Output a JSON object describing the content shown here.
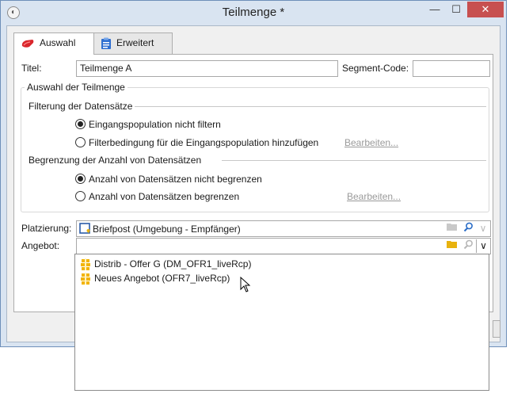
{
  "window": {
    "title": "Teilmenge *",
    "close_glyph": "✕",
    "min_glyph": "—",
    "max_glyph": "☐"
  },
  "tabs": [
    {
      "label": "Auswahl",
      "icon": "red-pill-icon",
      "active": true
    },
    {
      "label": "Erweitert",
      "icon": "clipboard-icon",
      "active": false
    }
  ],
  "form": {
    "title_label": "Titel:",
    "title_value": "Teilmenge A",
    "segment_label": "Segment-Code:",
    "segment_value": ""
  },
  "selection": {
    "group_title": "Auswahl der Teilmenge",
    "filter_section": "Filterung der Datensätze",
    "filter_options": [
      {
        "label": "Eingangspopulation nicht filtern",
        "selected": true
      },
      {
        "label": "Filterbedingung für die Eingangspopulation hinzufügen",
        "selected": false
      }
    ],
    "filter_edit": "Bearbeiten...",
    "limit_section": "Begrenzung der Anzahl von Datensätzen",
    "limit_options": [
      {
        "label": "Anzahl von Datensätzen nicht begrenzen",
        "selected": true
      },
      {
        "label": "Anzahl von Datensätzen begrenzen",
        "selected": false
      }
    ],
    "limit_edit": "Bearbeiten..."
  },
  "placement": {
    "label": "Platzierung:",
    "value": "Briefpost (Umgebung - Empfänger)"
  },
  "offer": {
    "label": "Angebot:",
    "value": "",
    "options": [
      "Distrib - Offer G (DM_OFR1_liveRcp)",
      "Neues Angebot (OFR7_liveRcp)"
    ]
  },
  "colors": {
    "accent_red": "#d9262c",
    "folder_yellow": "#e8b20e",
    "title_bg": "#d9e4f1"
  }
}
